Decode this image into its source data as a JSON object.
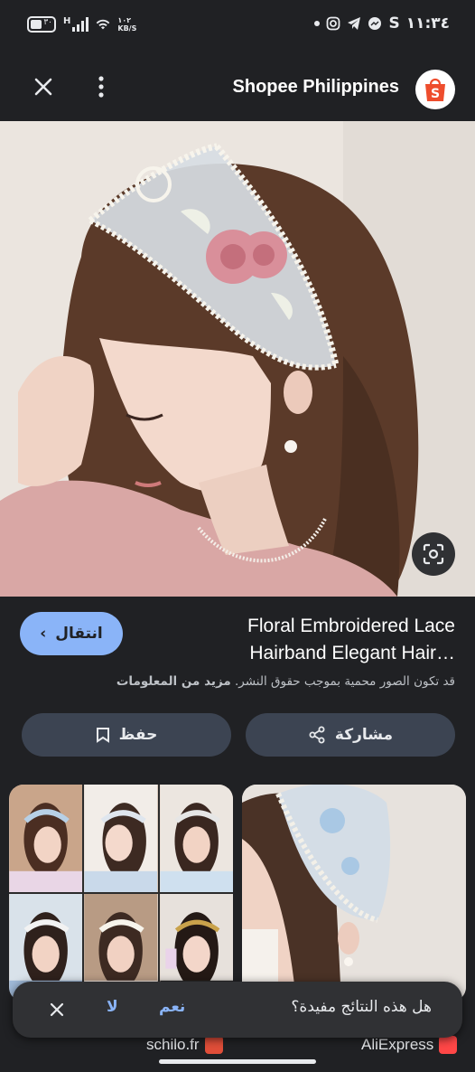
{
  "status_bar": {
    "battery": "٣٠",
    "network": "H",
    "speed_value": "١٠٢",
    "speed_unit": "KB/S",
    "time": "١١:٣٤"
  },
  "app_bar": {
    "title": "Shopee Philippines",
    "logo_letter": "S"
  },
  "product": {
    "title_line1": "Floral Embroidered Lace",
    "title_line2": "Hairband Elegant Hair…",
    "visit_label": "انتقال",
    "copyright": "قد تكون الصور محمية بموجب حقوق النشر.",
    "learn_more": "مزيد من المعلومات"
  },
  "actions": {
    "save_label": "حفظ",
    "share_label": "مشاركة"
  },
  "feedback": {
    "question": "هل هذه النتائج مفيدة؟",
    "yes": "نعم",
    "no": "لا"
  },
  "sources": {
    "left": "schilo.fr",
    "right": "AliExpress"
  },
  "colors": {
    "accent": "#8ab4f8",
    "background": "#202124",
    "button": "#3c4452",
    "shopee": "#ee4d2d"
  }
}
